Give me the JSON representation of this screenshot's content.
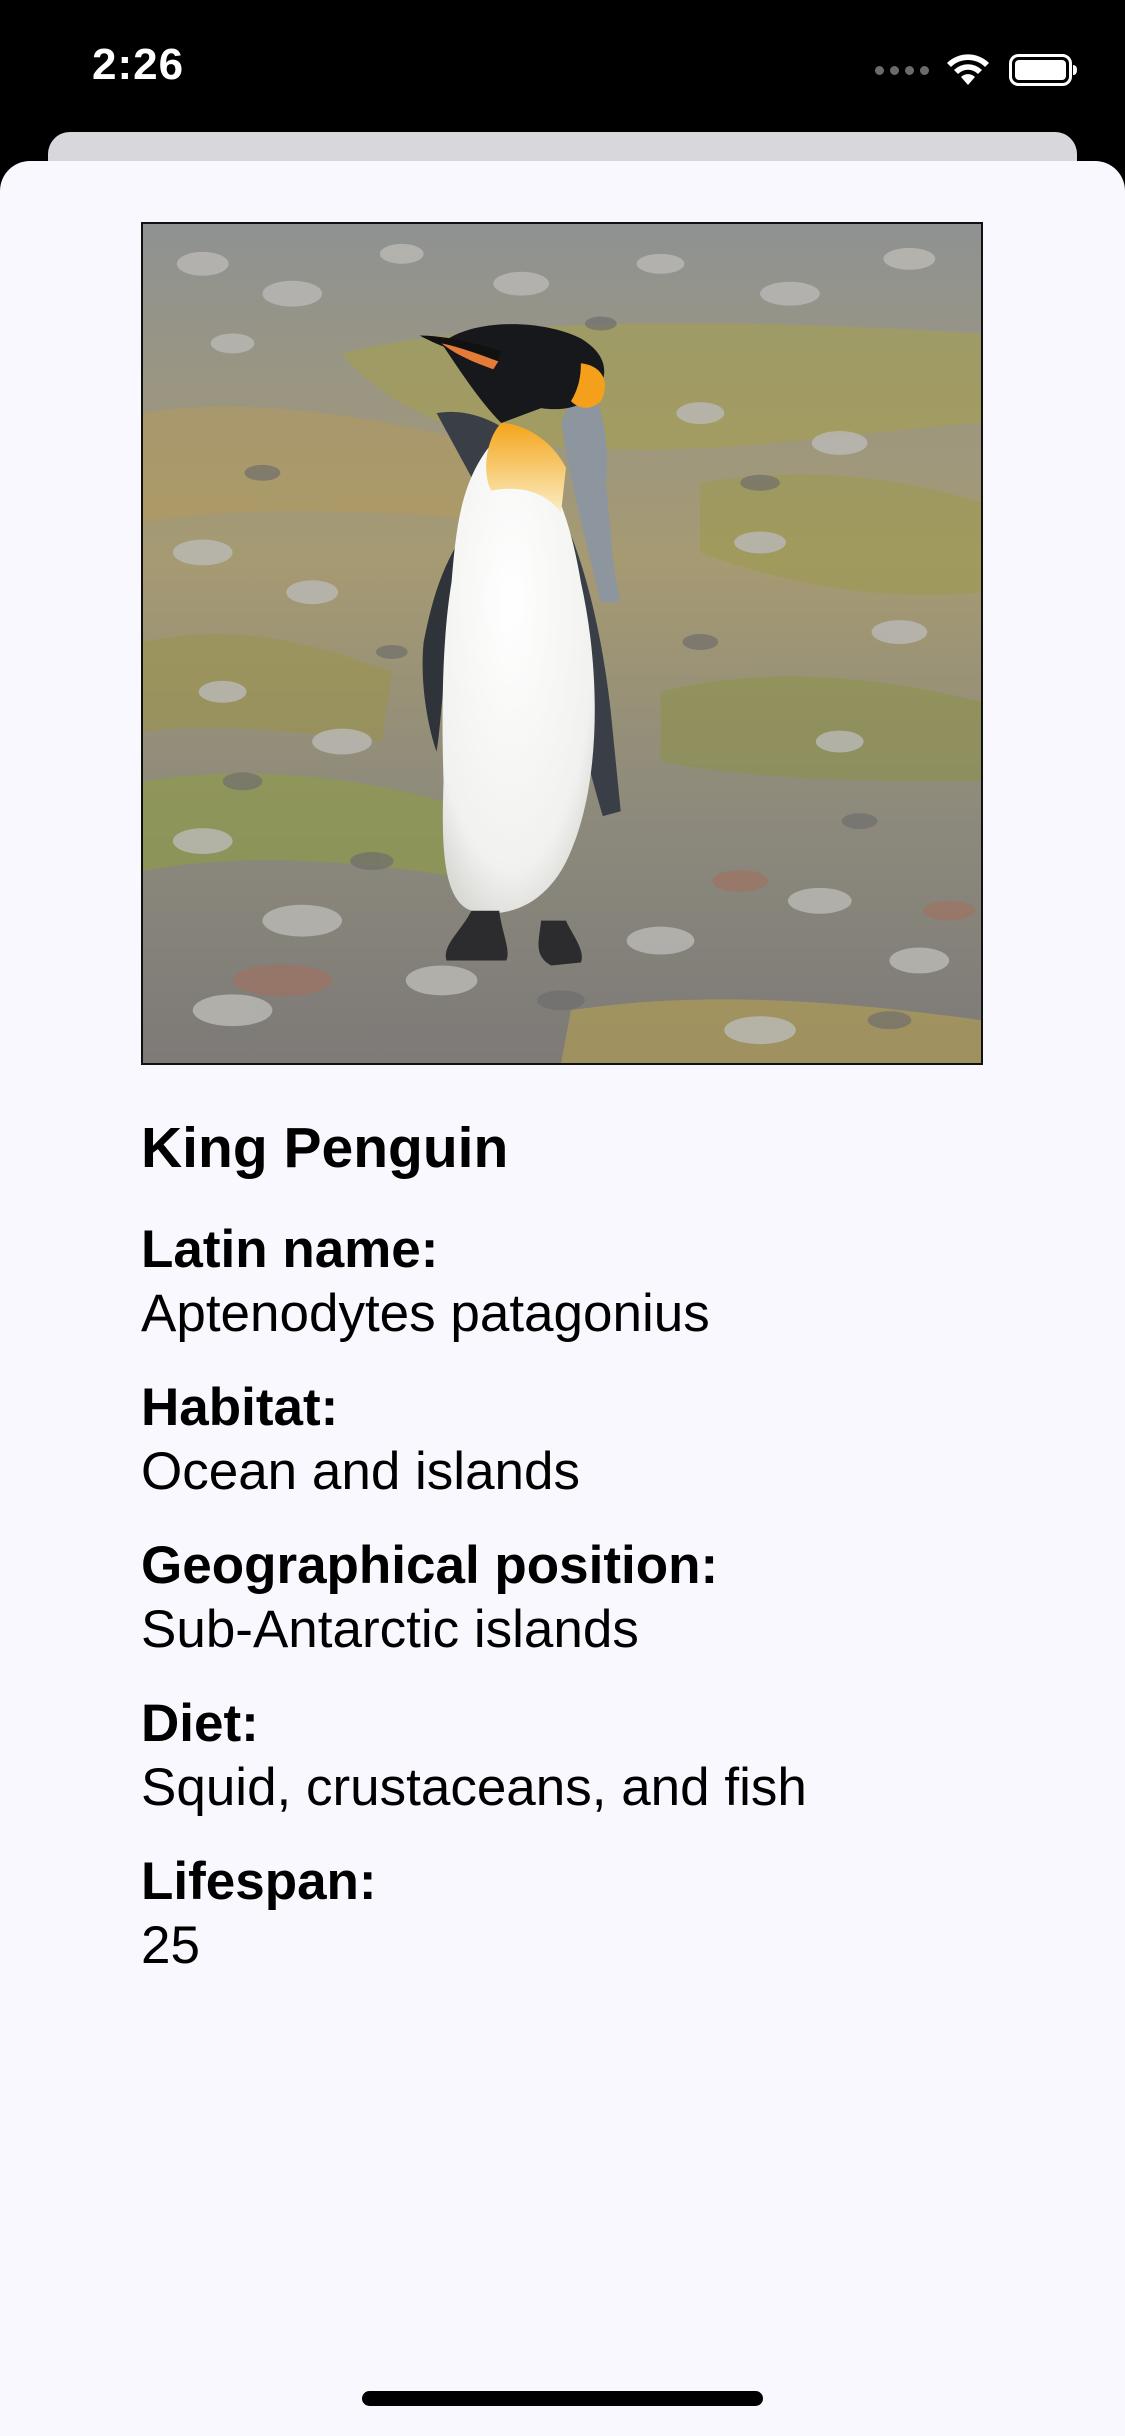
{
  "status_bar": {
    "time": "2:26",
    "icons": [
      "cellular-signal-icon",
      "wifi-icon",
      "battery-icon"
    ]
  },
  "animal": {
    "image_alt": "King Penguin standing on pebbles",
    "name": "King Penguin",
    "fields": [
      {
        "label": "Latin name:",
        "value": "Aptenodytes patagonius"
      },
      {
        "label": "Habitat:",
        "value": "Ocean and islands"
      },
      {
        "label": "Geographical position:",
        "value": "Sub-Antarctic islands"
      },
      {
        "label": "Diet:",
        "value": "Squid, crustaceans, and fish"
      },
      {
        "label": "Lifespan:",
        "value": "25"
      }
    ]
  },
  "colors": {
    "sheet_background": "#f9f8fe",
    "status_bar_background": "#000000",
    "text": "#000000"
  }
}
